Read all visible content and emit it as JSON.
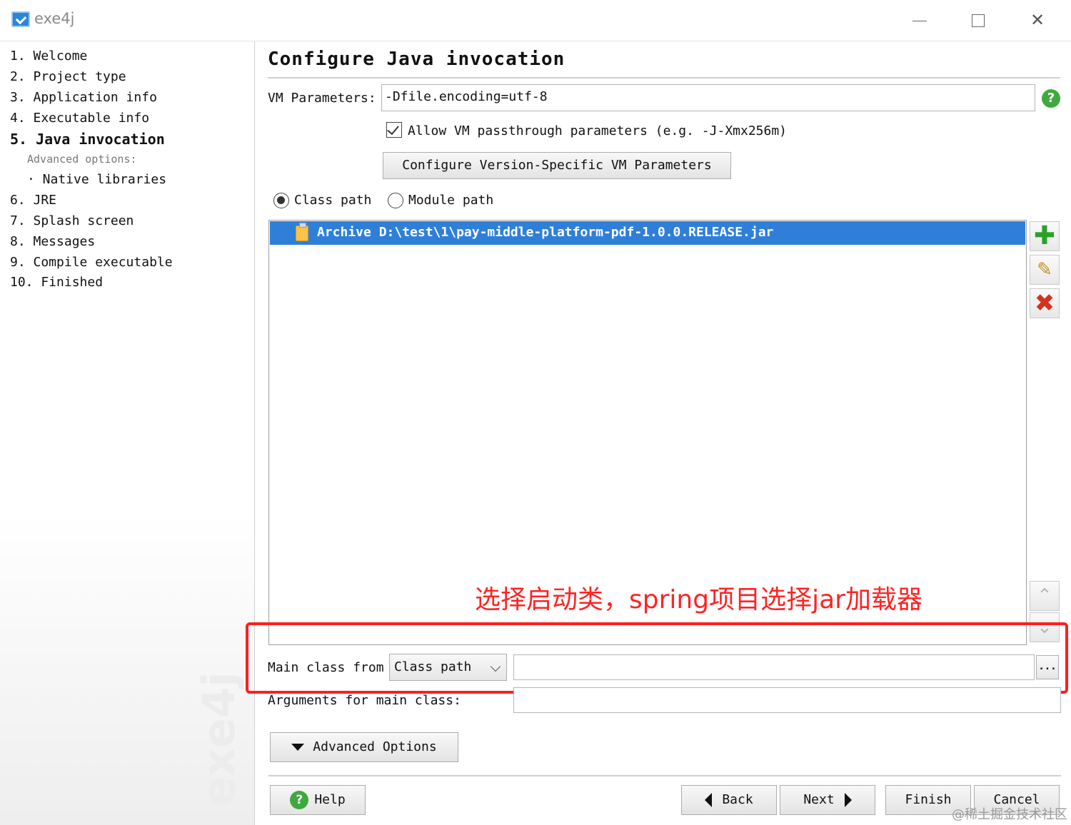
{
  "window": {
    "title": "exe4j"
  },
  "sidebar": {
    "steps": [
      {
        "label": "1. Welcome"
      },
      {
        "label": "2. Project type"
      },
      {
        "label": "3. Application info"
      },
      {
        "label": "4. Executable info"
      },
      {
        "label": "5. Java invocation"
      },
      {
        "label": "6. JRE"
      },
      {
        "label": "7. Splash screen"
      },
      {
        "label": "8. Messages"
      },
      {
        "label": "9. Compile executable"
      },
      {
        "label": "10. Finished"
      }
    ],
    "advanced_label": "Advanced options:",
    "native_libraries": "· Native libraries",
    "logo_text": "exe4j"
  },
  "main": {
    "title": "Configure Java invocation",
    "vm_parameters_label": "VM Parameters:",
    "vm_parameters_value": "-Dfile.encoding=utf-8",
    "allow_passthrough_label": "Allow VM passthrough parameters (e.g. -J-Xmx256m)",
    "allow_passthrough_checked": true,
    "version_specific_button": "Configure Version-Specific VM Parameters",
    "class_path_label": "Class path",
    "module_path_label": "Module path",
    "selected_path_mode": "Class path",
    "classpath_entries": [
      {
        "text": "Archive D:\\test\\1\\pay-middle-platform-pdf-1.0.0.RELEASE.jar",
        "icon": "jar-icon",
        "selected": true
      }
    ],
    "main_class_from_label": "Main class from",
    "main_class_source": "Class path",
    "main_class_value": "",
    "arguments_label": "Arguments for main class:",
    "arguments_value": "",
    "advanced_options_button": "Advanced Options",
    "browse_button": "..."
  },
  "annotation": {
    "text": "选择启动类，spring项目选择jar加载器",
    "color": "#ff2323"
  },
  "footer": {
    "help": "Help",
    "back": "Back",
    "next": "Next",
    "finish": "Finish",
    "cancel": "Cancel"
  },
  "watermark": "@稀土掘金技术社区",
  "colors": {
    "selection": "#2f7fd9",
    "highlight": "#ff1e1e",
    "help_green": "#3fa93f"
  }
}
